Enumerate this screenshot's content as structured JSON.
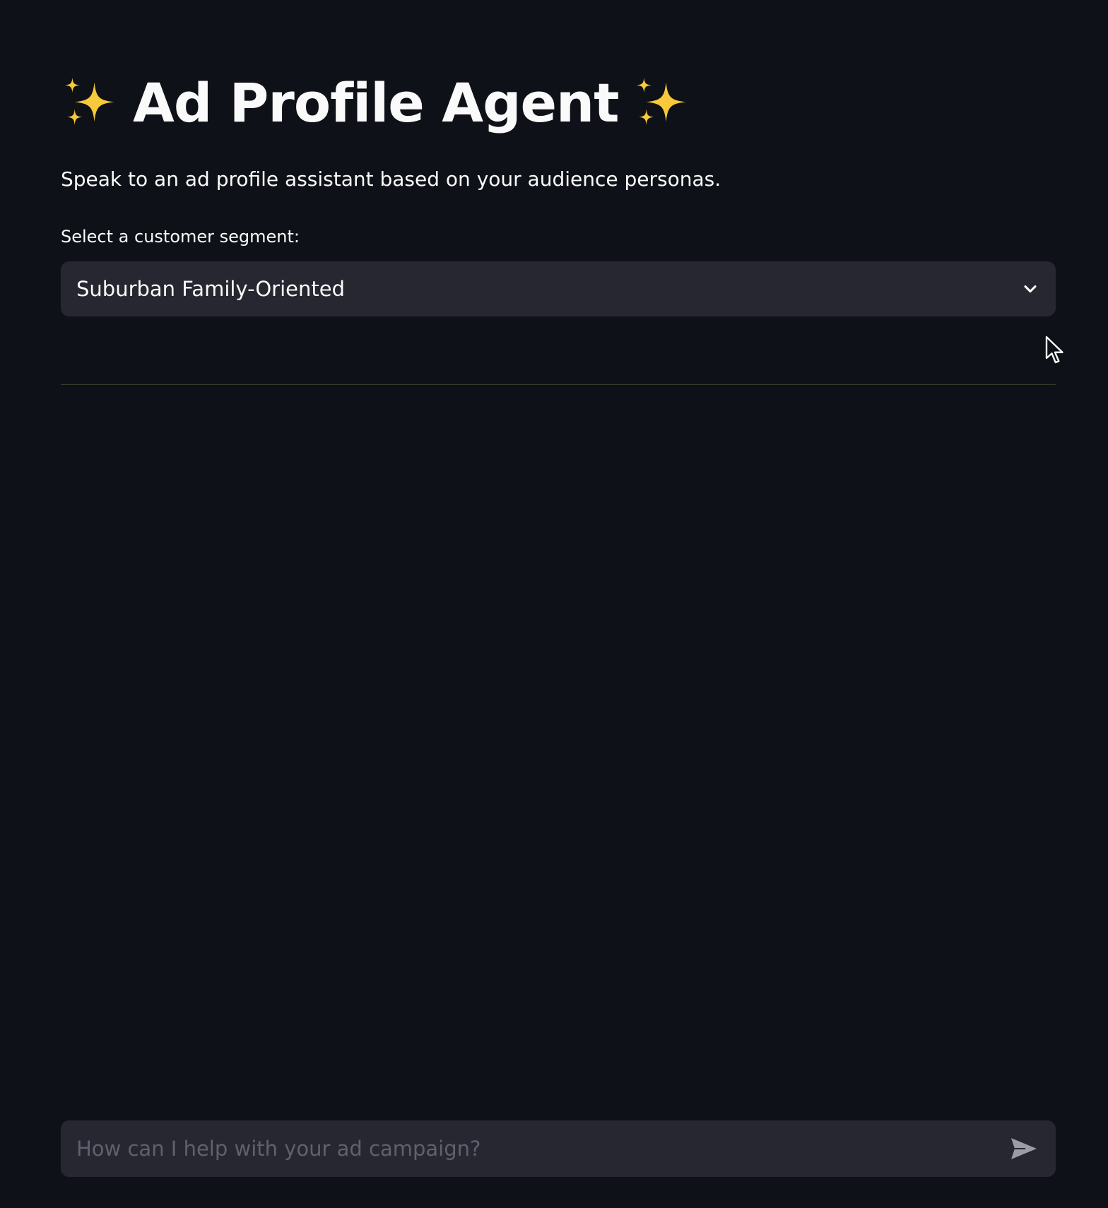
{
  "header": {
    "title": "Ad Profile Agent",
    "left_icon": "sparkles-icon",
    "right_icon": "sparkles-icon"
  },
  "intro": {
    "subtitle": "Speak to an ad profile assistant based on your audience personas."
  },
  "segment_select": {
    "label": "Select a customer segment:",
    "value": "Suburban Family-Oriented",
    "icon": "chevron-down-icon"
  },
  "chat": {
    "placeholder": "How can I help with your ad campaign?",
    "value": "",
    "send_icon": "send-icon"
  },
  "colors": {
    "background": "#0e1117",
    "surface": "#262730",
    "text": "#fafafa",
    "placeholder": "#5f6170",
    "sparkle": "#f7c93b"
  }
}
